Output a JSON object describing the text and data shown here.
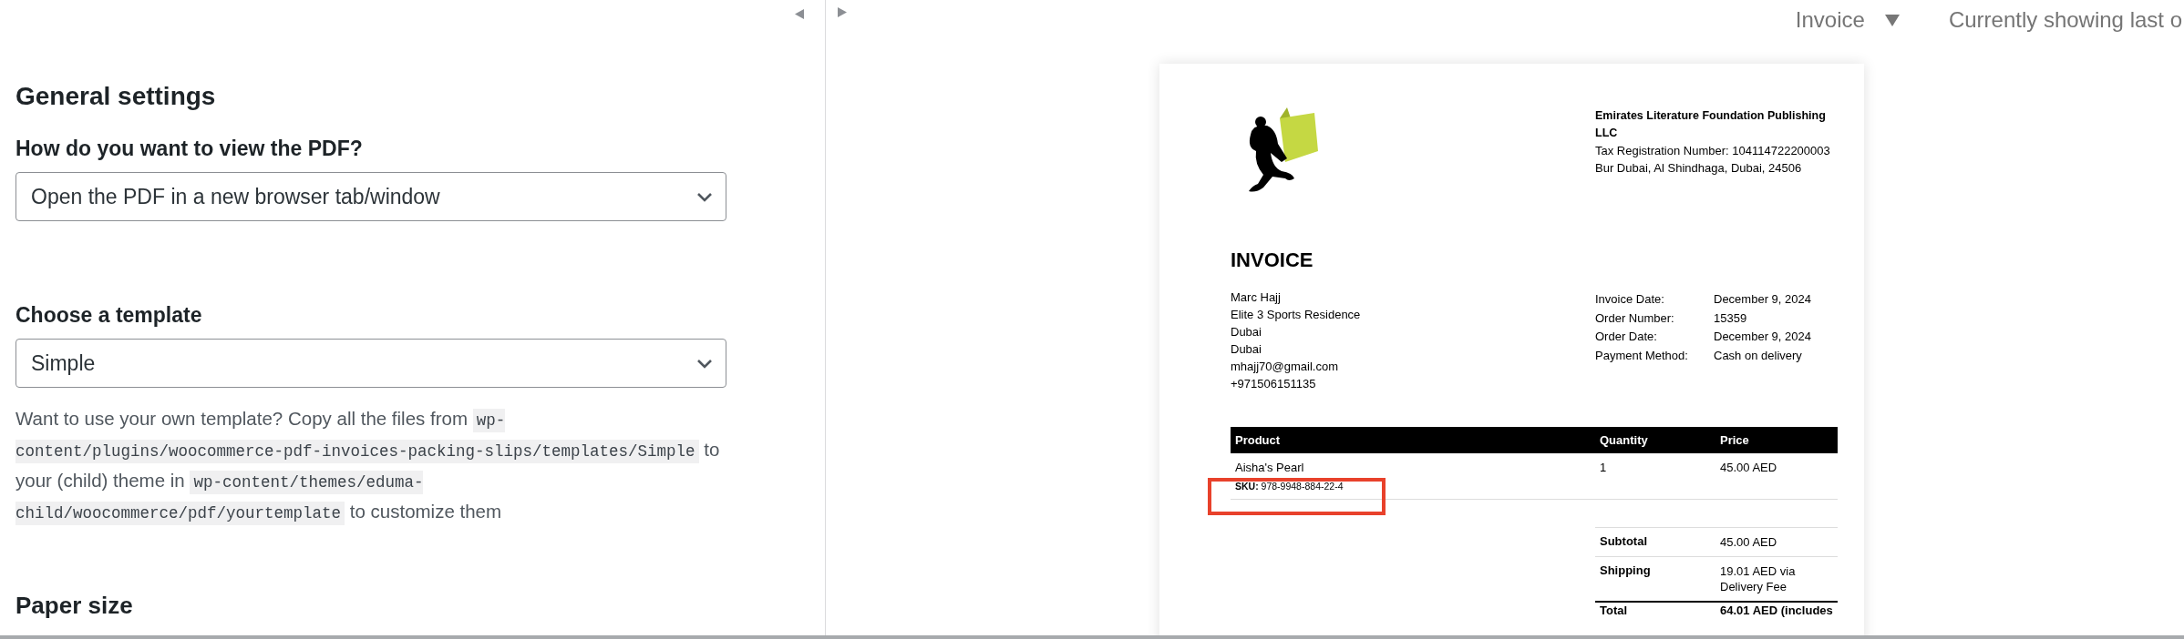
{
  "settings_panel": {
    "title": "General settings",
    "fields": [
      {
        "label": "How do you want to view the PDF?",
        "value": "Open the PDF in a new browser tab/window"
      },
      {
        "label": "Choose a template",
        "value": "Simple"
      }
    ],
    "help_parts": [
      {
        "kind": "text",
        "text": "Want to use your own template? Copy all the files from "
      },
      {
        "kind": "code",
        "text": "wp-content/plugins/woocommerce-pdf-invoices-packing-slips/templates/Simple"
      },
      {
        "kind": "text",
        "text": " to your (child) theme in "
      },
      {
        "kind": "code",
        "text": "wp-content/themes/eduma-child/woocommerce/pdf/yourtemplate"
      },
      {
        "kind": "text",
        "text": " to customize them"
      }
    ],
    "next_heading": "Paper size"
  },
  "preview_bar": {
    "document_type": "Invoice",
    "note": "Currently showing last o"
  },
  "invoice": {
    "company": {
      "name": "Emirates Literature Foundation Publishing LLC",
      "lines": [
        "Tax Registration Number: 104114722200003",
        "Bur Dubai, Al Shindhaga, Dubai, 24506"
      ]
    },
    "title": "INVOICE",
    "billing": [
      "Marc Hajj",
      "Elite 3 Sports Residence",
      "Dubai",
      "Dubai",
      "mhajj70@gmail.com",
      "+971506151135"
    ],
    "meta": [
      {
        "label": "Invoice Date:",
        "value": "December 9, 2024"
      },
      {
        "label": "Order Number:",
        "value": "15359"
      },
      {
        "label": "Order Date:",
        "value": "December 9, 2024"
      },
      {
        "label": "Payment Method:",
        "value": "Cash on delivery"
      }
    ],
    "columns": [
      "Product",
      "Quantity",
      "Price"
    ],
    "items": [
      {
        "product": "Aisha's Pearl",
        "sku": "**SKU:** 978-9948-884-22-4",
        "quantity": "1",
        "price": "45.00 AED"
      }
    ],
    "totals": [
      {
        "kind": "normal",
        "label": "Subtotal",
        "value": "45.00 AED"
      },
      {
        "kind": "normal",
        "label": "Shipping",
        "value": "19.01 AED via Delivery Fee"
      },
      {
        "kind": "grand",
        "label": "Total",
        "value": "64.01 AED (includes"
      }
    ]
  }
}
